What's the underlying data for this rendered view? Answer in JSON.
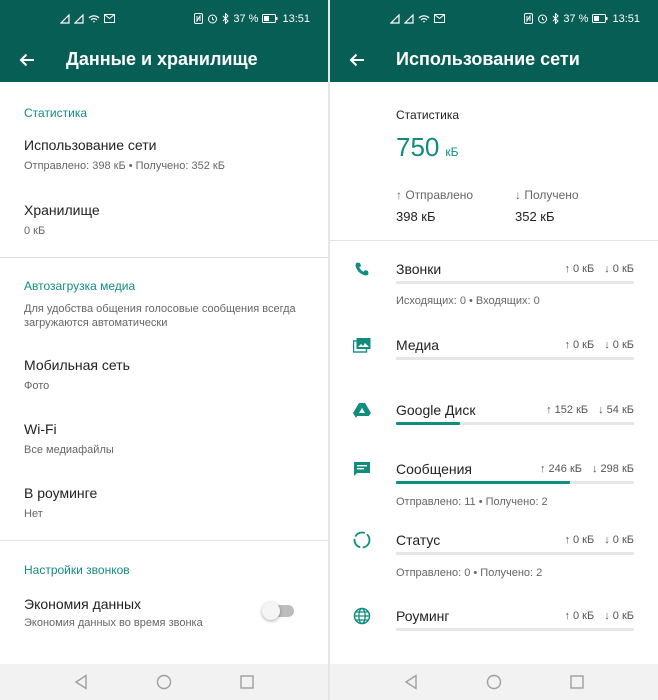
{
  "status_bar": {
    "battery": "37 %",
    "time": "13:51"
  },
  "left_screen": {
    "title": "Данные и хранилище",
    "sections": {
      "stats": {
        "header": "Статистика",
        "network_usage": {
          "title": "Использование сети",
          "subtitle": "Отправлено: 398 кБ • Получено: 352 кБ"
        },
        "storage": {
          "title": "Хранилище",
          "subtitle": "0 кБ"
        }
      },
      "media": {
        "header": "Автозагрузка медиа",
        "description": "Для удобства общения голосовые сообщения всегда загружаются автоматически",
        "mobile": {
          "title": "Мобильная сеть",
          "subtitle": "Фото"
        },
        "wifi": {
          "title": "Wi-Fi",
          "subtitle": "Все медиафайлы"
        },
        "roaming": {
          "title": "В роуминге",
          "subtitle": "Нет"
        }
      },
      "calls": {
        "header": "Настройки звонков",
        "data_saver": {
          "title": "Экономия данных",
          "subtitle": "Экономия данных во время звонка",
          "enabled": false
        }
      }
    }
  },
  "right_screen": {
    "title": "Использование сети",
    "stats_label": "Статистика",
    "total_value": "750",
    "total_unit": "кБ",
    "sent_label": "Отправлено",
    "sent_value": "398 кБ",
    "received_label": "Получено",
    "received_value": "352 кБ",
    "arrow_up": "↑",
    "arrow_down": "↓",
    "categories": [
      {
        "icon": "phone-icon",
        "name": "Звонки",
        "up": "0 кБ",
        "down": "0 кБ",
        "usage_fraction": 0,
        "sub": "Исходящих: 0 • Входящих: 0"
      },
      {
        "icon": "media-icon",
        "name": "Медиа",
        "up": "0 кБ",
        "down": "0 кБ",
        "usage_fraction": 0,
        "sub": ""
      },
      {
        "icon": "google-drive-icon",
        "name": "Google Диск",
        "up": "152 кБ",
        "down": "54 кБ",
        "usage_fraction": 0.27,
        "sub": ""
      },
      {
        "icon": "message-icon",
        "name": "Сообщения",
        "up": "246 кБ",
        "down": "298 кБ",
        "usage_fraction": 0.73,
        "sub": "Отправлено: 11 • Получено: 2"
      },
      {
        "icon": "status-icon",
        "name": "Статус",
        "up": "0 кБ",
        "down": "0 кБ",
        "usage_fraction": 0,
        "sub": "Отправлено: 0 • Получено: 2"
      },
      {
        "icon": "globe-icon",
        "name": "Роуминг",
        "up": "0 кБ",
        "down": "0 кБ",
        "usage_fraction": 0,
        "sub": ""
      }
    ]
  },
  "colors": {
    "primary": "#075e54",
    "accent": "#128c7e"
  }
}
